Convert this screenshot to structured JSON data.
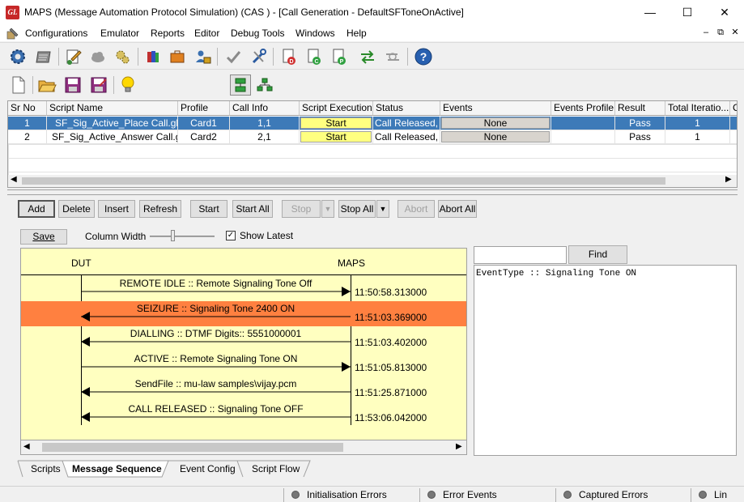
{
  "window": {
    "title": "MAPS (Message Automation Protocol Simulation)  (CAS ) - [Call Generation  - DefaultSFToneOnActive]",
    "logo_text": "GL",
    "controls": {
      "minimize": "—",
      "maximize": "☐",
      "close": "✕"
    }
  },
  "menu": {
    "items": [
      "Configurations",
      "Emulator",
      "Reports",
      "Editor",
      "Debug Tools",
      "Windows",
      "Help"
    ],
    "mdi_controls": [
      "–",
      "⧉",
      "✕"
    ]
  },
  "toolbar1": {
    "icons": [
      "gear-icon",
      "list-icon",
      "edit-script-icon",
      "cloud-icon",
      "gears-icon",
      "books-icon",
      "briefcase-icon",
      "lock-user-icon",
      "check-tool-icon",
      "tools-icon",
      "d-document-icon",
      "c-document-icon",
      "p-document-icon",
      "transfer-arrows-icon",
      "transfer-disabled-icon",
      "help-icon"
    ]
  },
  "toolbar2": {
    "icons": [
      "new-file-icon",
      "open-folder-icon",
      "save-icon",
      "save-as-icon",
      "lightbulb-icon",
      "tile-vertical-icon",
      "tree-view-icon"
    ]
  },
  "grid": {
    "columns": [
      "Sr No",
      "Script Name",
      "Profile",
      "Call Info",
      "Script Execution",
      "Status",
      "Events",
      "Events Profile",
      "Result",
      "Total Iteratio...",
      "C"
    ],
    "rows": [
      {
        "sr": "1",
        "script": "SF_Sig_Active_Place Call.gls",
        "profile": "Card1",
        "callinfo": "1,1",
        "exec": "Start",
        "status": "Call Released, ...",
        "events": "None",
        "events_profile": "",
        "result": "Pass",
        "total": "1"
      },
      {
        "sr": "2",
        "script": "SF_Sig_Active_Answer Call.gls",
        "profile": "Card2",
        "callinfo": "2,1",
        "exec": "Start",
        "status": "Call Released, ...",
        "events": "None",
        "events_profile": "",
        "result": "Pass",
        "total": "1"
      }
    ]
  },
  "buttons": {
    "add": "Add",
    "delete": "Delete",
    "insert": "Insert",
    "refresh": "Refresh",
    "start": "Start",
    "start_all": "Start All",
    "stop": "Stop",
    "stop_all": "Stop All",
    "abort": "Abort",
    "abort_all": "Abort All"
  },
  "msgpanel": {
    "save": "Save",
    "column_width_label": "Column Width",
    "show_latest_label": "Show Latest",
    "show_latest_checked": true,
    "left_entity": "DUT",
    "right_entity": "MAPS",
    "find_button": "Find",
    "find_value": "",
    "event_text": "EventType :: Signaling Tone ON",
    "highlight_color": "#ff8040",
    "background_color": "#ffffc0"
  },
  "messages": [
    {
      "label": "REMOTE IDLE :: Remote Signaling Tone Off",
      "time": "11:50:58.313000",
      "direction": "to-maps",
      "highlight": false
    },
    {
      "label": "SEIZURE :: Signaling Tone 2400 ON",
      "time": "11:51:03.369000",
      "direction": "to-dut",
      "highlight": true
    },
    {
      "label": "DIALLING :: DTMF Digits:: 5551000001",
      "time": "11:51:03.402000",
      "direction": "to-dut",
      "highlight": false
    },
    {
      "label": "ACTIVE :: Remote Signaling Tone ON",
      "time": "11:51:05.813000",
      "direction": "to-maps",
      "highlight": false
    },
    {
      "label": "SendFile  :: mu-law samples\\vijay.pcm",
      "time": "11:51:25.871000",
      "direction": "to-dut",
      "highlight": false
    },
    {
      "label": "CALL RELEASED :: Signaling Tone OFF",
      "time": "11:53:06.042000",
      "direction": "to-dut",
      "highlight": false
    }
  ],
  "tabs": [
    {
      "label": "Scripts",
      "active": false
    },
    {
      "label": "Message Sequence",
      "active": true
    },
    {
      "label": "Event Config",
      "active": false
    },
    {
      "label": "Script Flow",
      "active": false
    }
  ],
  "statusbar": [
    "Initialisation Errors",
    "Error Events",
    "Captured Errors",
    "Lin"
  ]
}
